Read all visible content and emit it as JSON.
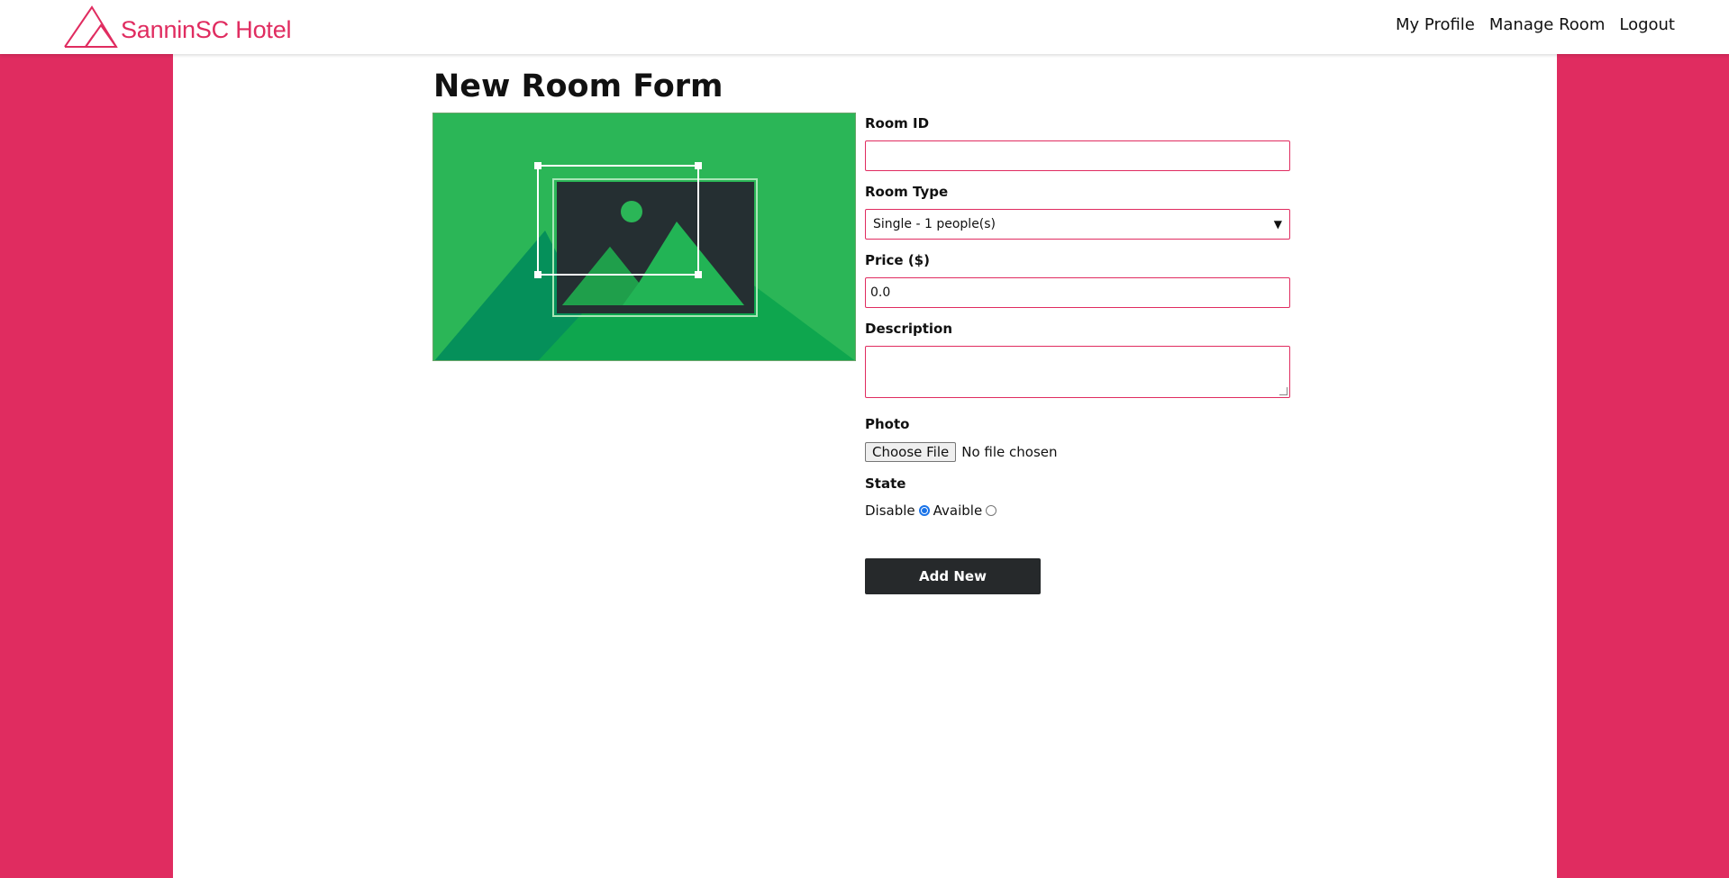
{
  "brand": {
    "name": "SanninSC Hotel",
    "color": "#e02c60"
  },
  "nav": {
    "items": [
      {
        "label": "My Profile"
      },
      {
        "label": "Manage Room"
      },
      {
        "label": "Logout"
      }
    ]
  },
  "page": {
    "title": "New Room Form"
  },
  "preview": {
    "icon": "image-placeholder-icon",
    "colors": {
      "bg": "#2bb657",
      "dark": "#252f32",
      "light": "#22c55e"
    }
  },
  "form": {
    "room_id": {
      "label": "Room ID",
      "value": ""
    },
    "room_type": {
      "label": "Room Type",
      "selected": "Single - 1 people(s)"
    },
    "price": {
      "label": "Price ($)",
      "value": "0.0"
    },
    "description": {
      "label": "Description",
      "value": ""
    },
    "photo": {
      "label": "Photo",
      "button": "Choose File",
      "status": "No file chosen"
    },
    "state": {
      "label": "State",
      "options": [
        {
          "label": "Disable",
          "checked": true
        },
        {
          "label": "Avaible",
          "checked": false
        }
      ]
    },
    "submit_label": "Add New"
  },
  "colors": {
    "accent": "#e02c60",
    "button": "#26292b"
  }
}
